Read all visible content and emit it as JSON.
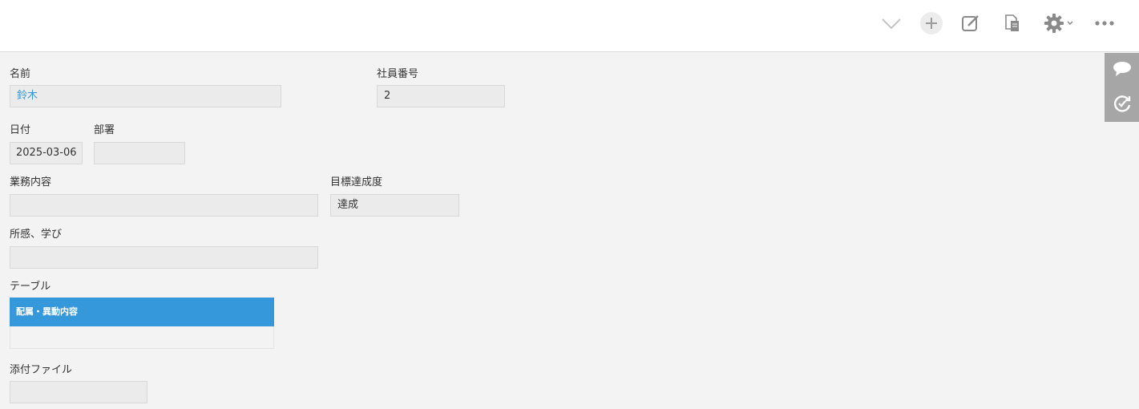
{
  "toolbar": {
    "icons": [
      "chevron-down-icon",
      "plus-icon",
      "edit-icon",
      "copy-document-icon",
      "gear-icon",
      "more-icon"
    ]
  },
  "side_panel": {
    "icons": [
      "comment-icon",
      "history-icon"
    ]
  },
  "fields": {
    "name": {
      "label": "名前",
      "value": "鈴木"
    },
    "employee_no": {
      "label": "社員番号",
      "value": "2"
    },
    "date": {
      "label": "日付",
      "value": "2025-03-06"
    },
    "department": {
      "label": "部署",
      "value": ""
    },
    "work_content": {
      "label": "業務内容",
      "value": ""
    },
    "goal_achievement": {
      "label": "目標達成度",
      "value": "達成"
    },
    "impressions": {
      "label": "所感、学び",
      "value": ""
    },
    "table": {
      "label": "テーブル",
      "column_header": "配属・異動内容"
    },
    "attachment": {
      "label": "添付ファイル",
      "value": ""
    }
  },
  "colors": {
    "accent": "#3498db",
    "background": "#f3f3f3",
    "side_panel": "#a6a6a6"
  }
}
